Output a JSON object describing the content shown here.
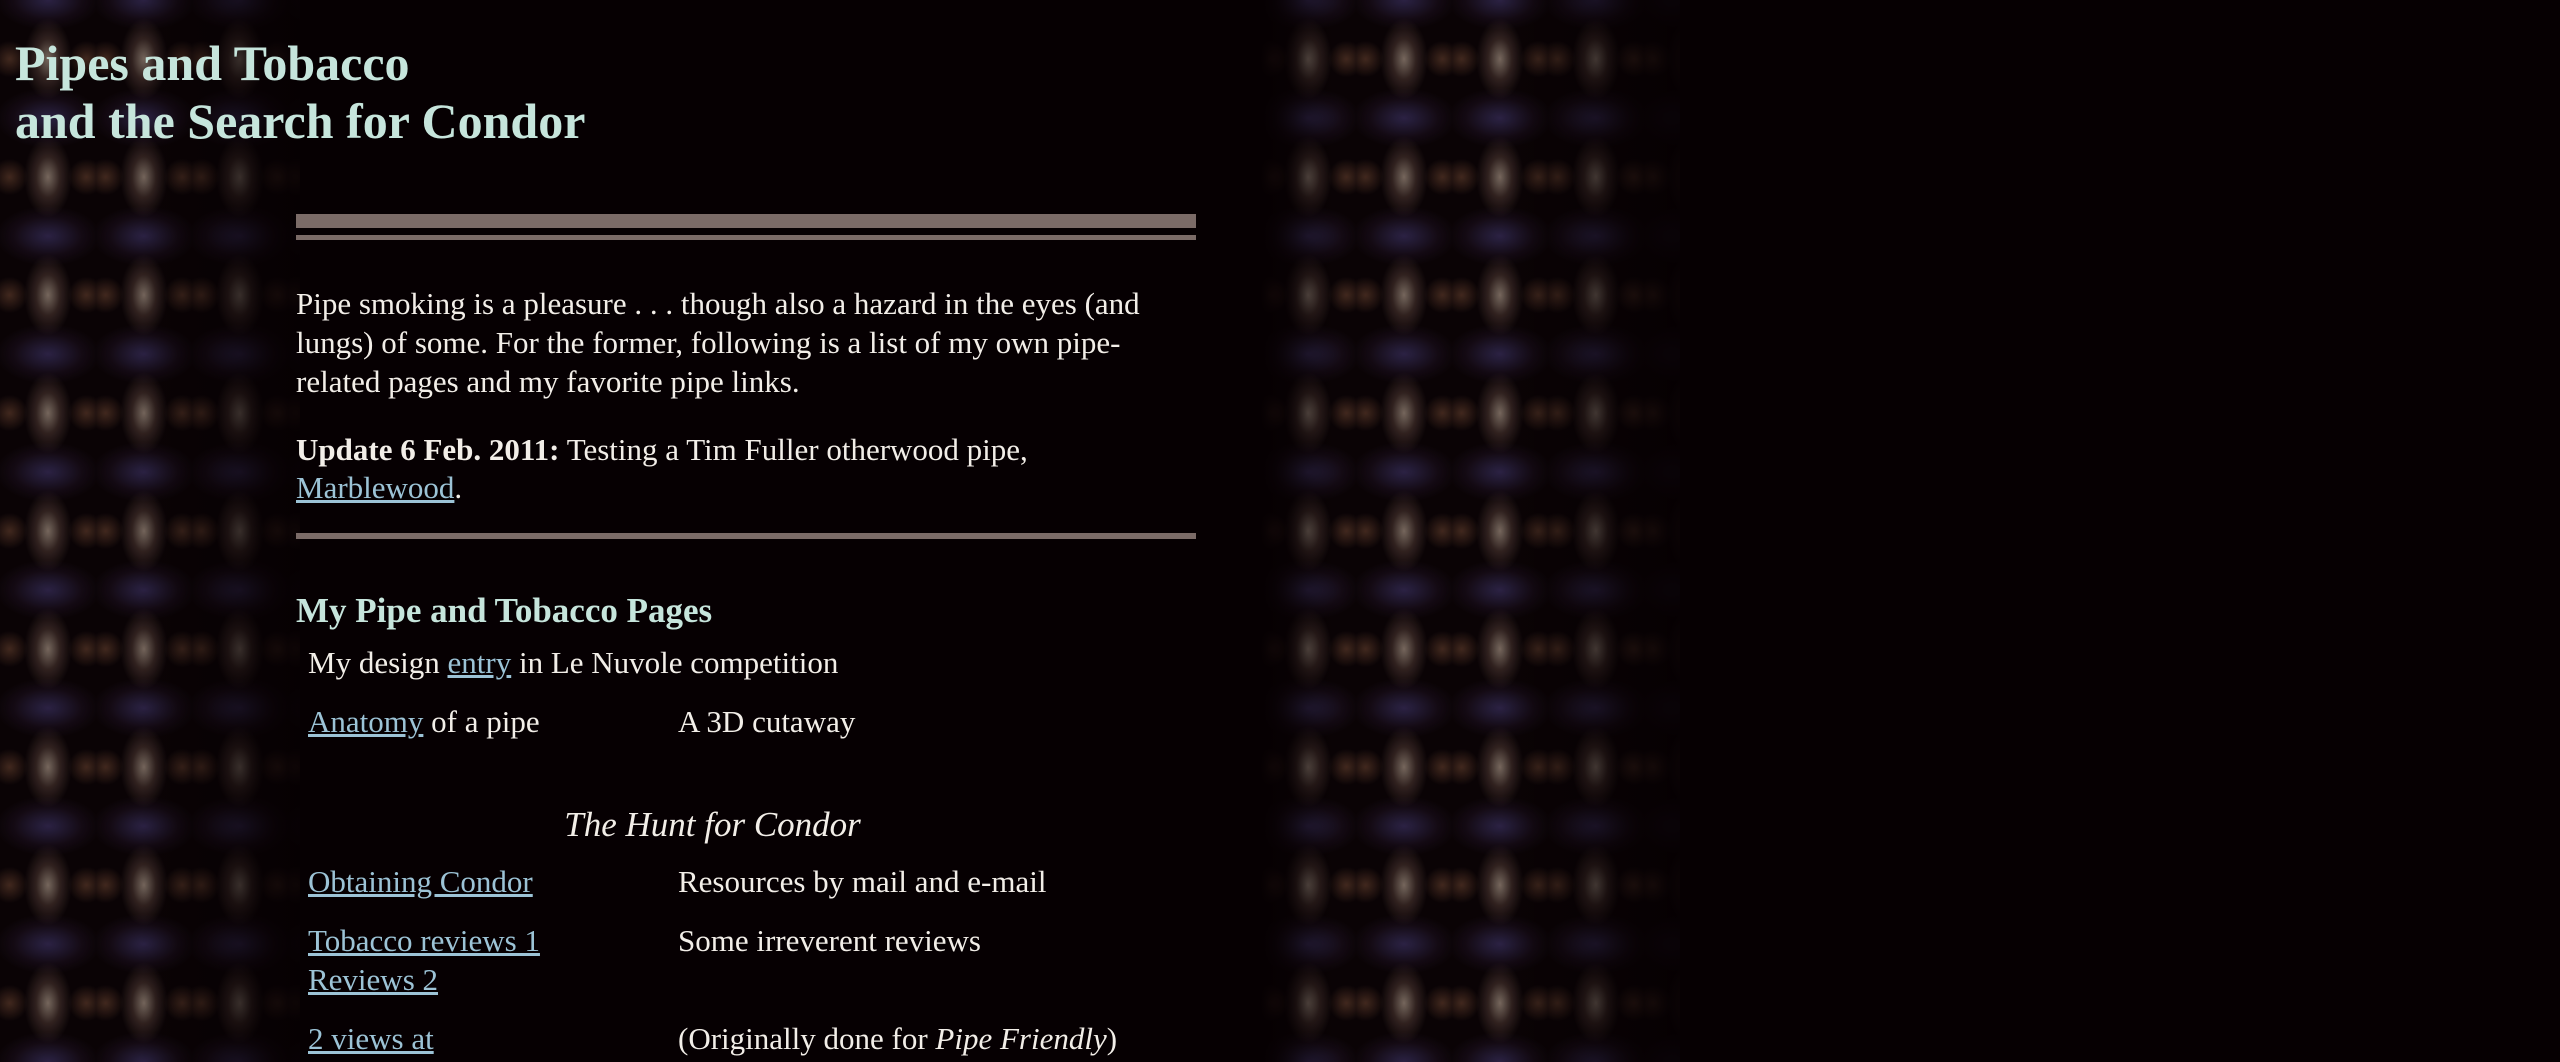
{
  "page": {
    "title_line1": "Pipes and Tobacco",
    "title_line2": "and the Search for Condor"
  },
  "intro": {
    "text": "Pipe smoking is a pleasure . . . though also a hazard in the eyes (and lungs) of some. For the former, following is a list of my own pipe-related pages and my favorite pipe links."
  },
  "update": {
    "label": "Update 6 Feb. 2011:",
    "text": " Testing a Tim Fuller otherwood pipe, ",
    "link": "Marblewood",
    "end": "."
  },
  "section": {
    "heading": "My Pipe and Tobacco Pages"
  },
  "rows": {
    "design": {
      "prefix": "My design ",
      "link": "entry",
      "suffix": " in Le Nuvole competition"
    },
    "anatomy": {
      "link": "Anatomy",
      "suffix": " of a pipe",
      "desc": "A 3D cutaway"
    },
    "hunt_heading": "The Hunt for Condor",
    "obtaining": {
      "link": "Obtaining Condor",
      "desc": "Resources by mail and e-mail"
    },
    "reviews": {
      "link1": "Tobacco reviews 1",
      "link2": "Reviews 2",
      "desc": "Some irreverent reviews"
    },
    "cut": {
      "left": "2 views at",
      "desc_prefix": "(Originally done for ",
      "desc_italic": "Pipe Friendly",
      "desc_suffix": ")"
    }
  },
  "colors": {
    "background": "#060002",
    "heading": "#c6e5dc",
    "text": "#f2eee8",
    "link": "#9cc3d6",
    "rule": "#7b6b67"
  }
}
